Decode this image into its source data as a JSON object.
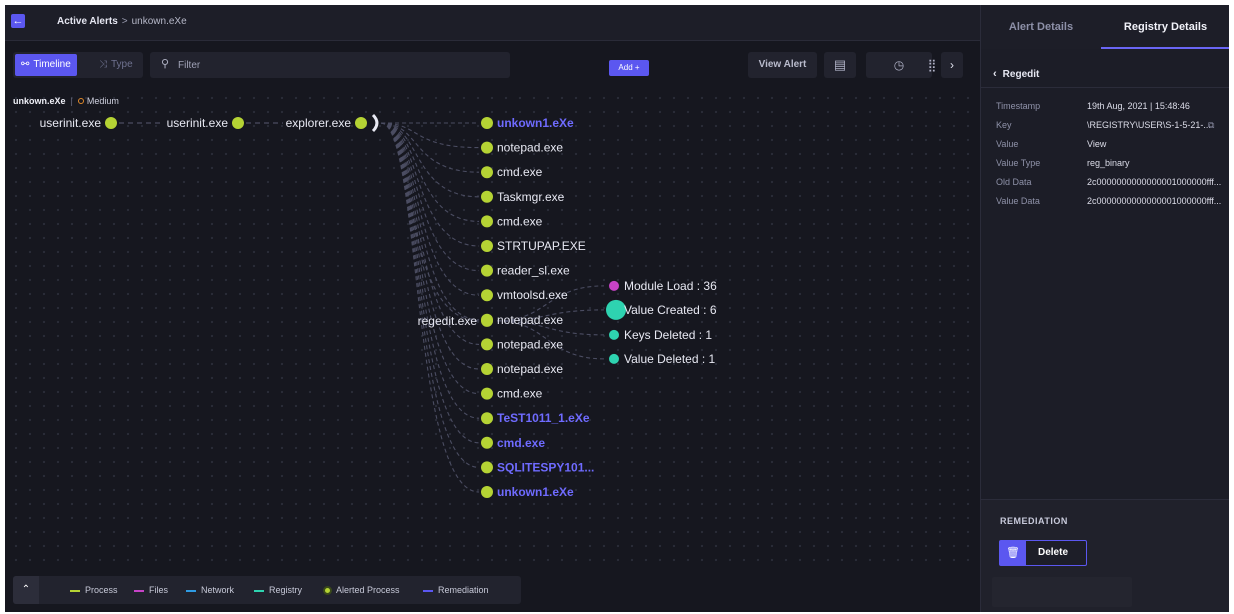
{
  "breadcrumb": {
    "first": "Active Alerts",
    "separator": ">",
    "second": "unkown.eXe"
  },
  "toolbar": {
    "timeline_label": "Timeline",
    "type_label": "Type",
    "filter_placeholder": "Filter",
    "add_label": "Add",
    "view_alert_label": "View Alert"
  },
  "alert": {
    "process": "unkown.eXe",
    "severity": "Medium"
  },
  "graph": {
    "chain": [
      "userinit.exe",
      "userinit.exe",
      "explorer.exe"
    ],
    "children": [
      {
        "label": "unkown1.eXe",
        "alerted": true
      },
      {
        "label": "notepad.exe",
        "alerted": false
      },
      {
        "label": "cmd.exe",
        "alerted": false
      },
      {
        "label": "Taskmgr.exe",
        "alerted": false
      },
      {
        "label": "cmd.exe",
        "alerted": false
      },
      {
        "label": "STRTUPAP.EXE",
        "alerted": false
      },
      {
        "label": "reader_sl.exe",
        "alerted": false
      },
      {
        "label": "vmtoolsd.exe",
        "alerted": false
      },
      {
        "label": "notepad.exe",
        "alerted": false
      },
      {
        "label": "notepad.exe",
        "alerted": false
      },
      {
        "label": "notepad.exe",
        "alerted": false
      },
      {
        "label": "cmd.exe",
        "alerted": false
      },
      {
        "label": "TeST1011_1.eXe",
        "alerted": true
      },
      {
        "label": "cmd.exe",
        "alerted": true
      },
      {
        "label": "SQLITESPY101...",
        "alerted": true
      },
      {
        "label": "unkown1.eXe",
        "alerted": true
      }
    ],
    "regedit": "regedit.exe",
    "events": [
      {
        "label": "Module Load : 36",
        "kind": "files"
      },
      {
        "label": "Value Created : 6",
        "kind": "registry-selected"
      },
      {
        "label": "Keys Deleted : 1",
        "kind": "registry"
      },
      {
        "label": "Value Deleted : 1",
        "kind": "registry"
      }
    ]
  },
  "legend": {
    "process": "Process",
    "files": "Files",
    "network": "Network",
    "registry": "Registry",
    "alerted": "Alerted Process",
    "remediation": "Remediation"
  },
  "panel": {
    "tab_alert": "Alert Details",
    "tab_registry": "Registry Details",
    "back_label": "Regedit",
    "details": [
      {
        "key": "Timestamp",
        "value": "19th Aug, 2021 | 15:48:46"
      },
      {
        "key": "Key",
        "value": "\\REGISTRY\\USER\\S-1-5-21-..."
      },
      {
        "key": "Value",
        "value": "View"
      },
      {
        "key": "Value Type",
        "value": "reg_binary"
      },
      {
        "key": "Old Data",
        "value": "2c0000000000000001000000fff..."
      },
      {
        "key": "Value Data",
        "value": "2c0000000000000001000000fff..."
      }
    ],
    "remediation_title": "REMEDIATION",
    "delete_label": "Delete"
  },
  "colors": {
    "accent": "#5b57f0",
    "process": "#b5d334",
    "files": "#c743c7",
    "network": "#2f9be3",
    "registry": "#2ed3b0",
    "alerted_text": "#6f6bff"
  }
}
